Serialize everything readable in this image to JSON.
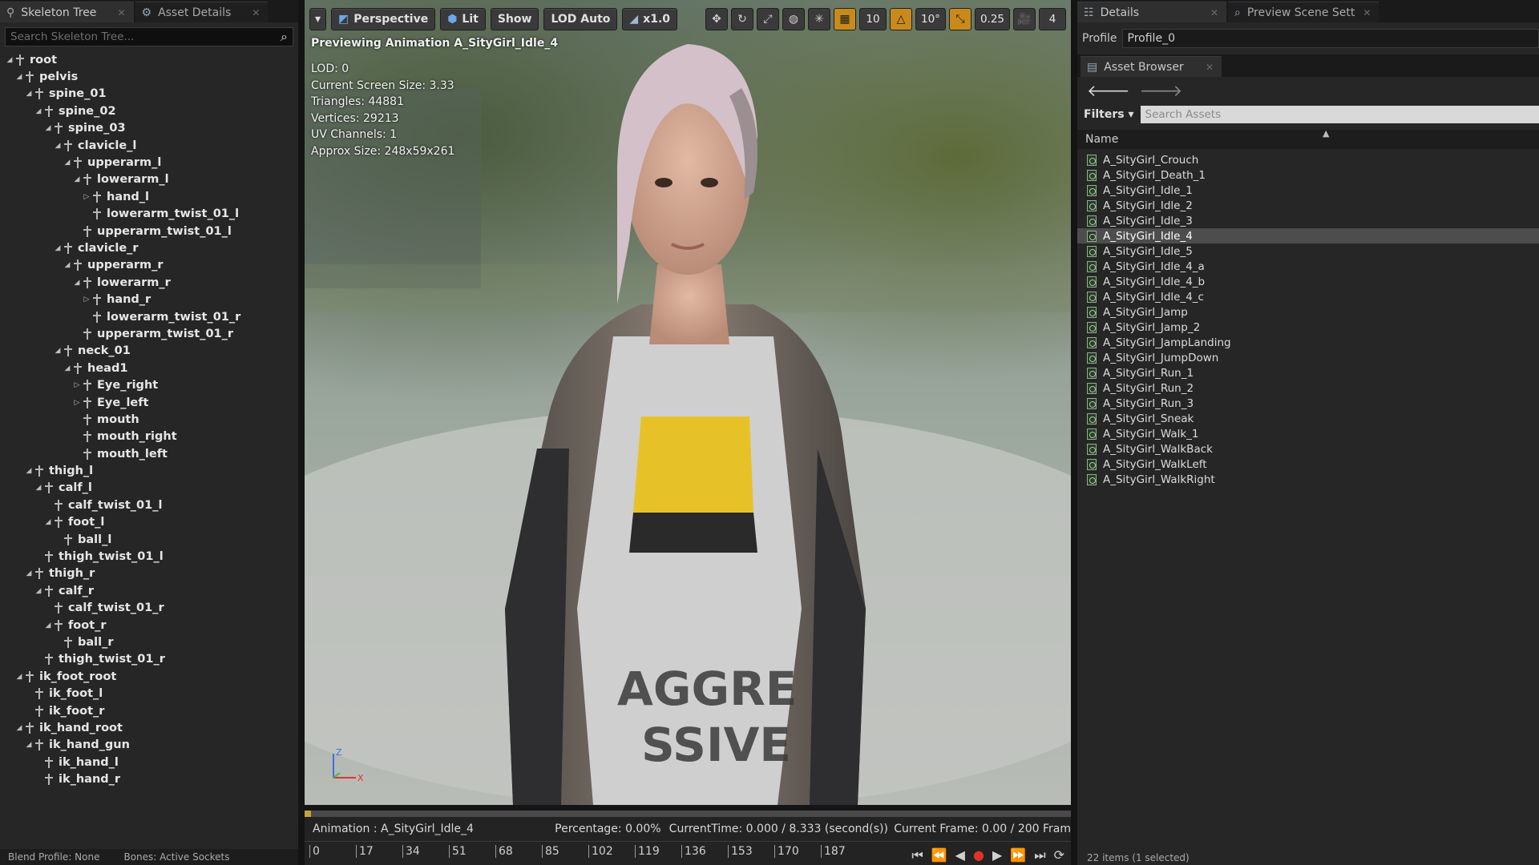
{
  "left_panel": {
    "tabs": [
      {
        "label": "Skeleton Tree",
        "active": true
      },
      {
        "label": "Asset Details",
        "active": false
      }
    ],
    "search_placeholder": "Search Skeleton Tree...",
    "bones": [
      {
        "name": "root",
        "depth": 0,
        "expander": "open"
      },
      {
        "name": "pelvis",
        "depth": 1,
        "expander": "open"
      },
      {
        "name": "spine_01",
        "depth": 2,
        "expander": "open"
      },
      {
        "name": "spine_02",
        "depth": 3,
        "expander": "open"
      },
      {
        "name": "spine_03",
        "depth": 4,
        "expander": "open"
      },
      {
        "name": "clavicle_l",
        "depth": 5,
        "expander": "open"
      },
      {
        "name": "upperarm_l",
        "depth": 6,
        "expander": "open"
      },
      {
        "name": "lowerarm_l",
        "depth": 7,
        "expander": "open"
      },
      {
        "name": "hand_l",
        "depth": 8,
        "expander": "closed"
      },
      {
        "name": "lowerarm_twist_01_l",
        "depth": 8,
        "expander": "none"
      },
      {
        "name": "upperarm_twist_01_l",
        "depth": 7,
        "expander": "none"
      },
      {
        "name": "clavicle_r",
        "depth": 5,
        "expander": "open"
      },
      {
        "name": "upperarm_r",
        "depth": 6,
        "expander": "open"
      },
      {
        "name": "lowerarm_r",
        "depth": 7,
        "expander": "open"
      },
      {
        "name": "hand_r",
        "depth": 8,
        "expander": "closed"
      },
      {
        "name": "lowerarm_twist_01_r",
        "depth": 8,
        "expander": "none"
      },
      {
        "name": "upperarm_twist_01_r",
        "depth": 7,
        "expander": "none"
      },
      {
        "name": "neck_01",
        "depth": 5,
        "expander": "open"
      },
      {
        "name": "head1",
        "depth": 6,
        "expander": "open"
      },
      {
        "name": "Eye_right",
        "depth": 7,
        "expander": "closed"
      },
      {
        "name": "Eye_left",
        "depth": 7,
        "expander": "closed"
      },
      {
        "name": "mouth",
        "depth": 7,
        "expander": "none"
      },
      {
        "name": "mouth_right",
        "depth": 7,
        "expander": "none"
      },
      {
        "name": "mouth_left",
        "depth": 7,
        "expander": "none"
      },
      {
        "name": "thigh_l",
        "depth": 2,
        "expander": "open"
      },
      {
        "name": "calf_l",
        "depth": 3,
        "expander": "open"
      },
      {
        "name": "calf_twist_01_l",
        "depth": 4,
        "expander": "none"
      },
      {
        "name": "foot_l",
        "depth": 4,
        "expander": "open"
      },
      {
        "name": "ball_l",
        "depth": 5,
        "expander": "none"
      },
      {
        "name": "thigh_twist_01_l",
        "depth": 3,
        "expander": "none"
      },
      {
        "name": "thigh_r",
        "depth": 2,
        "expander": "open"
      },
      {
        "name": "calf_r",
        "depth": 3,
        "expander": "open"
      },
      {
        "name": "calf_twist_01_r",
        "depth": 4,
        "expander": "none"
      },
      {
        "name": "foot_r",
        "depth": 4,
        "expander": "open"
      },
      {
        "name": "ball_r",
        "depth": 5,
        "expander": "none"
      },
      {
        "name": "thigh_twist_01_r",
        "depth": 3,
        "expander": "none"
      },
      {
        "name": "ik_foot_root",
        "depth": 1,
        "expander": "open"
      },
      {
        "name": "ik_foot_l",
        "depth": 2,
        "expander": "none"
      },
      {
        "name": "ik_foot_r",
        "depth": 2,
        "expander": "none"
      },
      {
        "name": "ik_hand_root",
        "depth": 1,
        "expander": "open"
      },
      {
        "name": "ik_hand_gun",
        "depth": 2,
        "expander": "open"
      },
      {
        "name": "ik_hand_l",
        "depth": 3,
        "expander": "none"
      },
      {
        "name": "ik_hand_r",
        "depth": 3,
        "expander": "none"
      }
    ],
    "footer": {
      "blend_profile": "Blend Profile: None",
      "bones_option": "Bones: Active Sockets"
    }
  },
  "viewport": {
    "toolbar": {
      "perspective": "Perspective",
      "lit": "Lit",
      "show": "Show",
      "lod": "LOD Auto",
      "speed": "x1.0",
      "grid_snap": "10",
      "rotation_snap": "10°",
      "scale_snap": "0.25",
      "camera_speed": "4"
    },
    "previewing": "Previewing Animation A_SityGirl_Idle_4",
    "stats": [
      "LOD: 0",
      "Current Screen Size: 3.33",
      "Triangles: 44881",
      "Vertices: 29213",
      "UV Channels: 1",
      "Approx Size: 248x59x261"
    ],
    "axis": {
      "z": "Z",
      "x": "X"
    }
  },
  "timeline": {
    "animation": "Animation :  A_SityGirl_Idle_4",
    "percentage": "Percentage:  0.00%",
    "current_time": "CurrentTime:  0.000 / 8.333 (second(s))",
    "current_frame": "Current Frame:  0.00 / 200 Fram",
    "ticks": [
      "0",
      "17",
      "34",
      "51",
      "68",
      "85",
      "102",
      "119",
      "136",
      "153",
      "170",
      "187"
    ]
  },
  "right_panel": {
    "tabs": [
      {
        "label": "Details",
        "active": true
      },
      {
        "label": "Preview Scene Sett",
        "active": false
      }
    ],
    "profile_label": "Profile",
    "profile_value": "Profile_0",
    "asset_browser_tab": "Asset Browser",
    "filters_label": "Filters",
    "search_placeholder": "Search Assets",
    "name_header": "Name",
    "assets": [
      "A_SityGirl_Crouch",
      "A_SityGirl_Death_1",
      "A_SityGirl_Idle_1",
      "A_SityGirl_Idle_2",
      "A_SityGirl_Idle_3",
      "A_SityGirl_Idle_4",
      "A_SityGirl_Idle_5",
      "A_SityGirl_Idle_4_a",
      "A_SityGirl_Idle_4_b",
      "A_SityGirl_Idle_4_c",
      "A_SityGirl_Jamp",
      "A_SityGirl_Jamp_2",
      "A_SityGirl_JampLanding",
      "A_SityGirl_JumpDown",
      "A_SityGirl_Run_1",
      "A_SityGirl_Run_2",
      "A_SityGirl_Run_3",
      "A_SityGirl_Sneak",
      "A_SityGirl_Walk_1",
      "A_SityGirl_WalkBack",
      "A_SityGirl_WalkLeft",
      "A_SityGirl_WalkRight"
    ],
    "selected_asset": "A_SityGirl_Idle_4",
    "footer": "22 items (1 selected)"
  },
  "colors": {
    "accent_orange": "#c98a1c",
    "record_red": "#e0322a",
    "lit_blue": "#6fa6e6"
  }
}
